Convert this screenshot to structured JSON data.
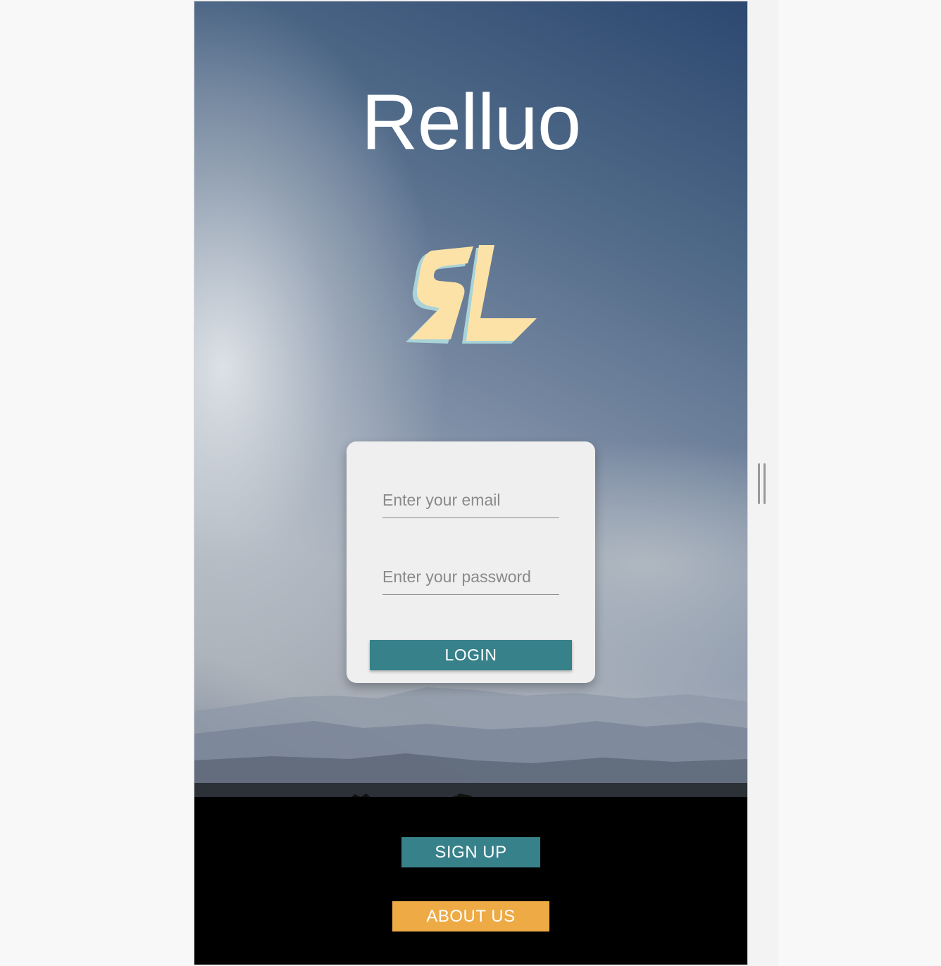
{
  "app": {
    "title": "Relluo",
    "logo_name": "relluo-sl-logo",
    "logo_text": "SL"
  },
  "login_form": {
    "email_placeholder": "Enter your email",
    "password_placeholder": "Enter your password",
    "login_label": "LOGIN"
  },
  "footer": {
    "signup_label": "SIGN UP",
    "about_label": "ABOUT US"
  },
  "colors": {
    "primary_teal": "#37818a",
    "accent_orange": "#eeaa45",
    "logo_cream": "#fde2a7",
    "logo_shadow": "#a9d3d8"
  }
}
